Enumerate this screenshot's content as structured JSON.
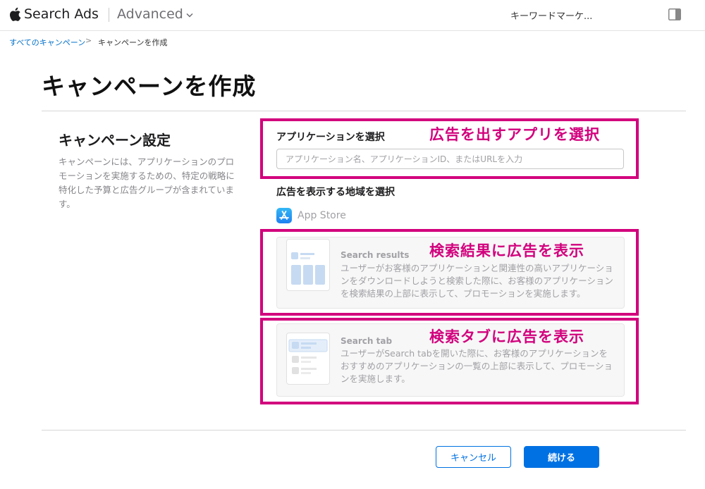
{
  "header": {
    "brand": "Search Ads",
    "mode": "Advanced",
    "account": "キーワードマーケ..."
  },
  "breadcrumb": {
    "root": "すべてのキャンペーン",
    "separator": ">",
    "current": "キャンペーンを作成"
  },
  "page": {
    "title": "キャンペーンを作成"
  },
  "settings": {
    "title": "キャンペーン設定",
    "description": "キャンペーンには、アプリケーションのプロモーションを実施するための、特定の戦略に特化した予算と広告グループが含まれています。"
  },
  "app_select": {
    "label": "アプリケーションを選択",
    "placeholder": "アプリケーション名、アプリケーションID、またはURLを入力",
    "value": ""
  },
  "region": {
    "label": "広告を表示する地域を選択",
    "store_name": "App Store"
  },
  "placements": [
    {
      "title": "Search results",
      "description": "ユーザーがお客様のアプリケーションと関連性の高いアプリケーションをダウンロードしようと検索した際に、お客様のアプリケーションを検索結果の上部に表示して、プロモーションを実施します。"
    },
    {
      "title": "Search tab",
      "description": "ユーザーがSearch tabを開いた際に、お客様のアプリケーションをおすすめのアプリケーションの一覧の上部に表示して、プロモーションを実施します。"
    }
  ],
  "annotations": [
    "広告を出すアプリを選択",
    "検索結果に広告を表示",
    "検索タブに広告を表示"
  ],
  "footer": {
    "cancel_label": "キャンセル",
    "next_label": "続ける"
  },
  "colors": {
    "accent": "#0071e3",
    "link": "#0070c9",
    "annotation": "#d2007d"
  }
}
